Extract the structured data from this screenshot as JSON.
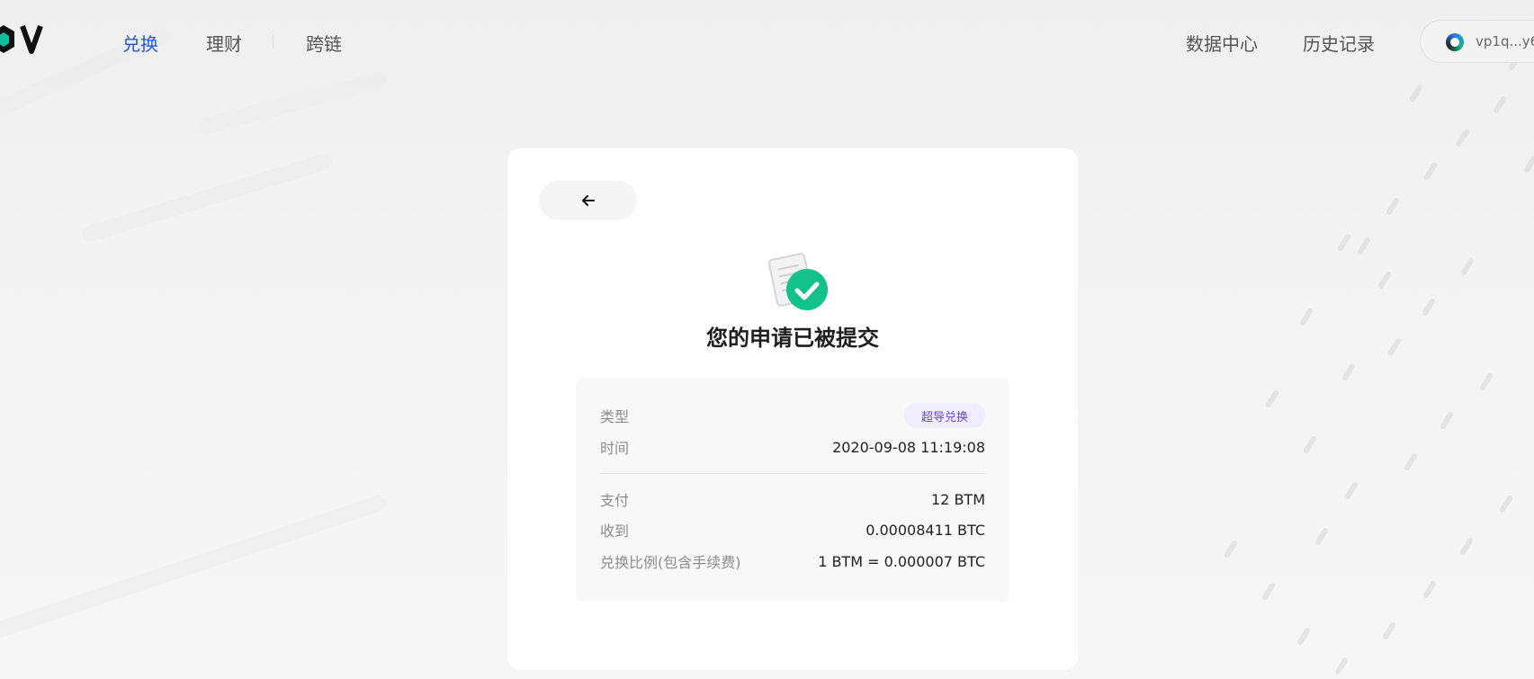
{
  "nav": {
    "items": [
      {
        "label": "兑换",
        "active": true
      },
      {
        "label": "理财",
        "active": false
      },
      {
        "label": "跨链",
        "active": false
      }
    ],
    "right_items": [
      {
        "label": "数据中心"
      },
      {
        "label": "历史记录"
      }
    ],
    "wallet": {
      "address": "vp1q...y6"
    }
  },
  "card": {
    "back_icon": "arrow-left-icon",
    "success_icon": "document-check-icon",
    "title": "您的申请已被提交",
    "details": {
      "type_label": "类型",
      "type_value": "超导兑换",
      "time_label": "时间",
      "time_value": "2020-09-08 11:19:08",
      "pay_label": "支付",
      "pay_value": "12 BTM",
      "receive_label": "收到",
      "receive_value": "0.00008411 BTC",
      "rate_label": "兑换比例(包含手续费)",
      "rate_value": "1 BTM = 0.000007 BTC"
    }
  },
  "colors": {
    "accent_blue": "#2457d6",
    "success_green": "#12c28a",
    "badge_purple": "#6b45d8",
    "badge_bg": "#efedff",
    "card_bg": "#ffffff"
  }
}
